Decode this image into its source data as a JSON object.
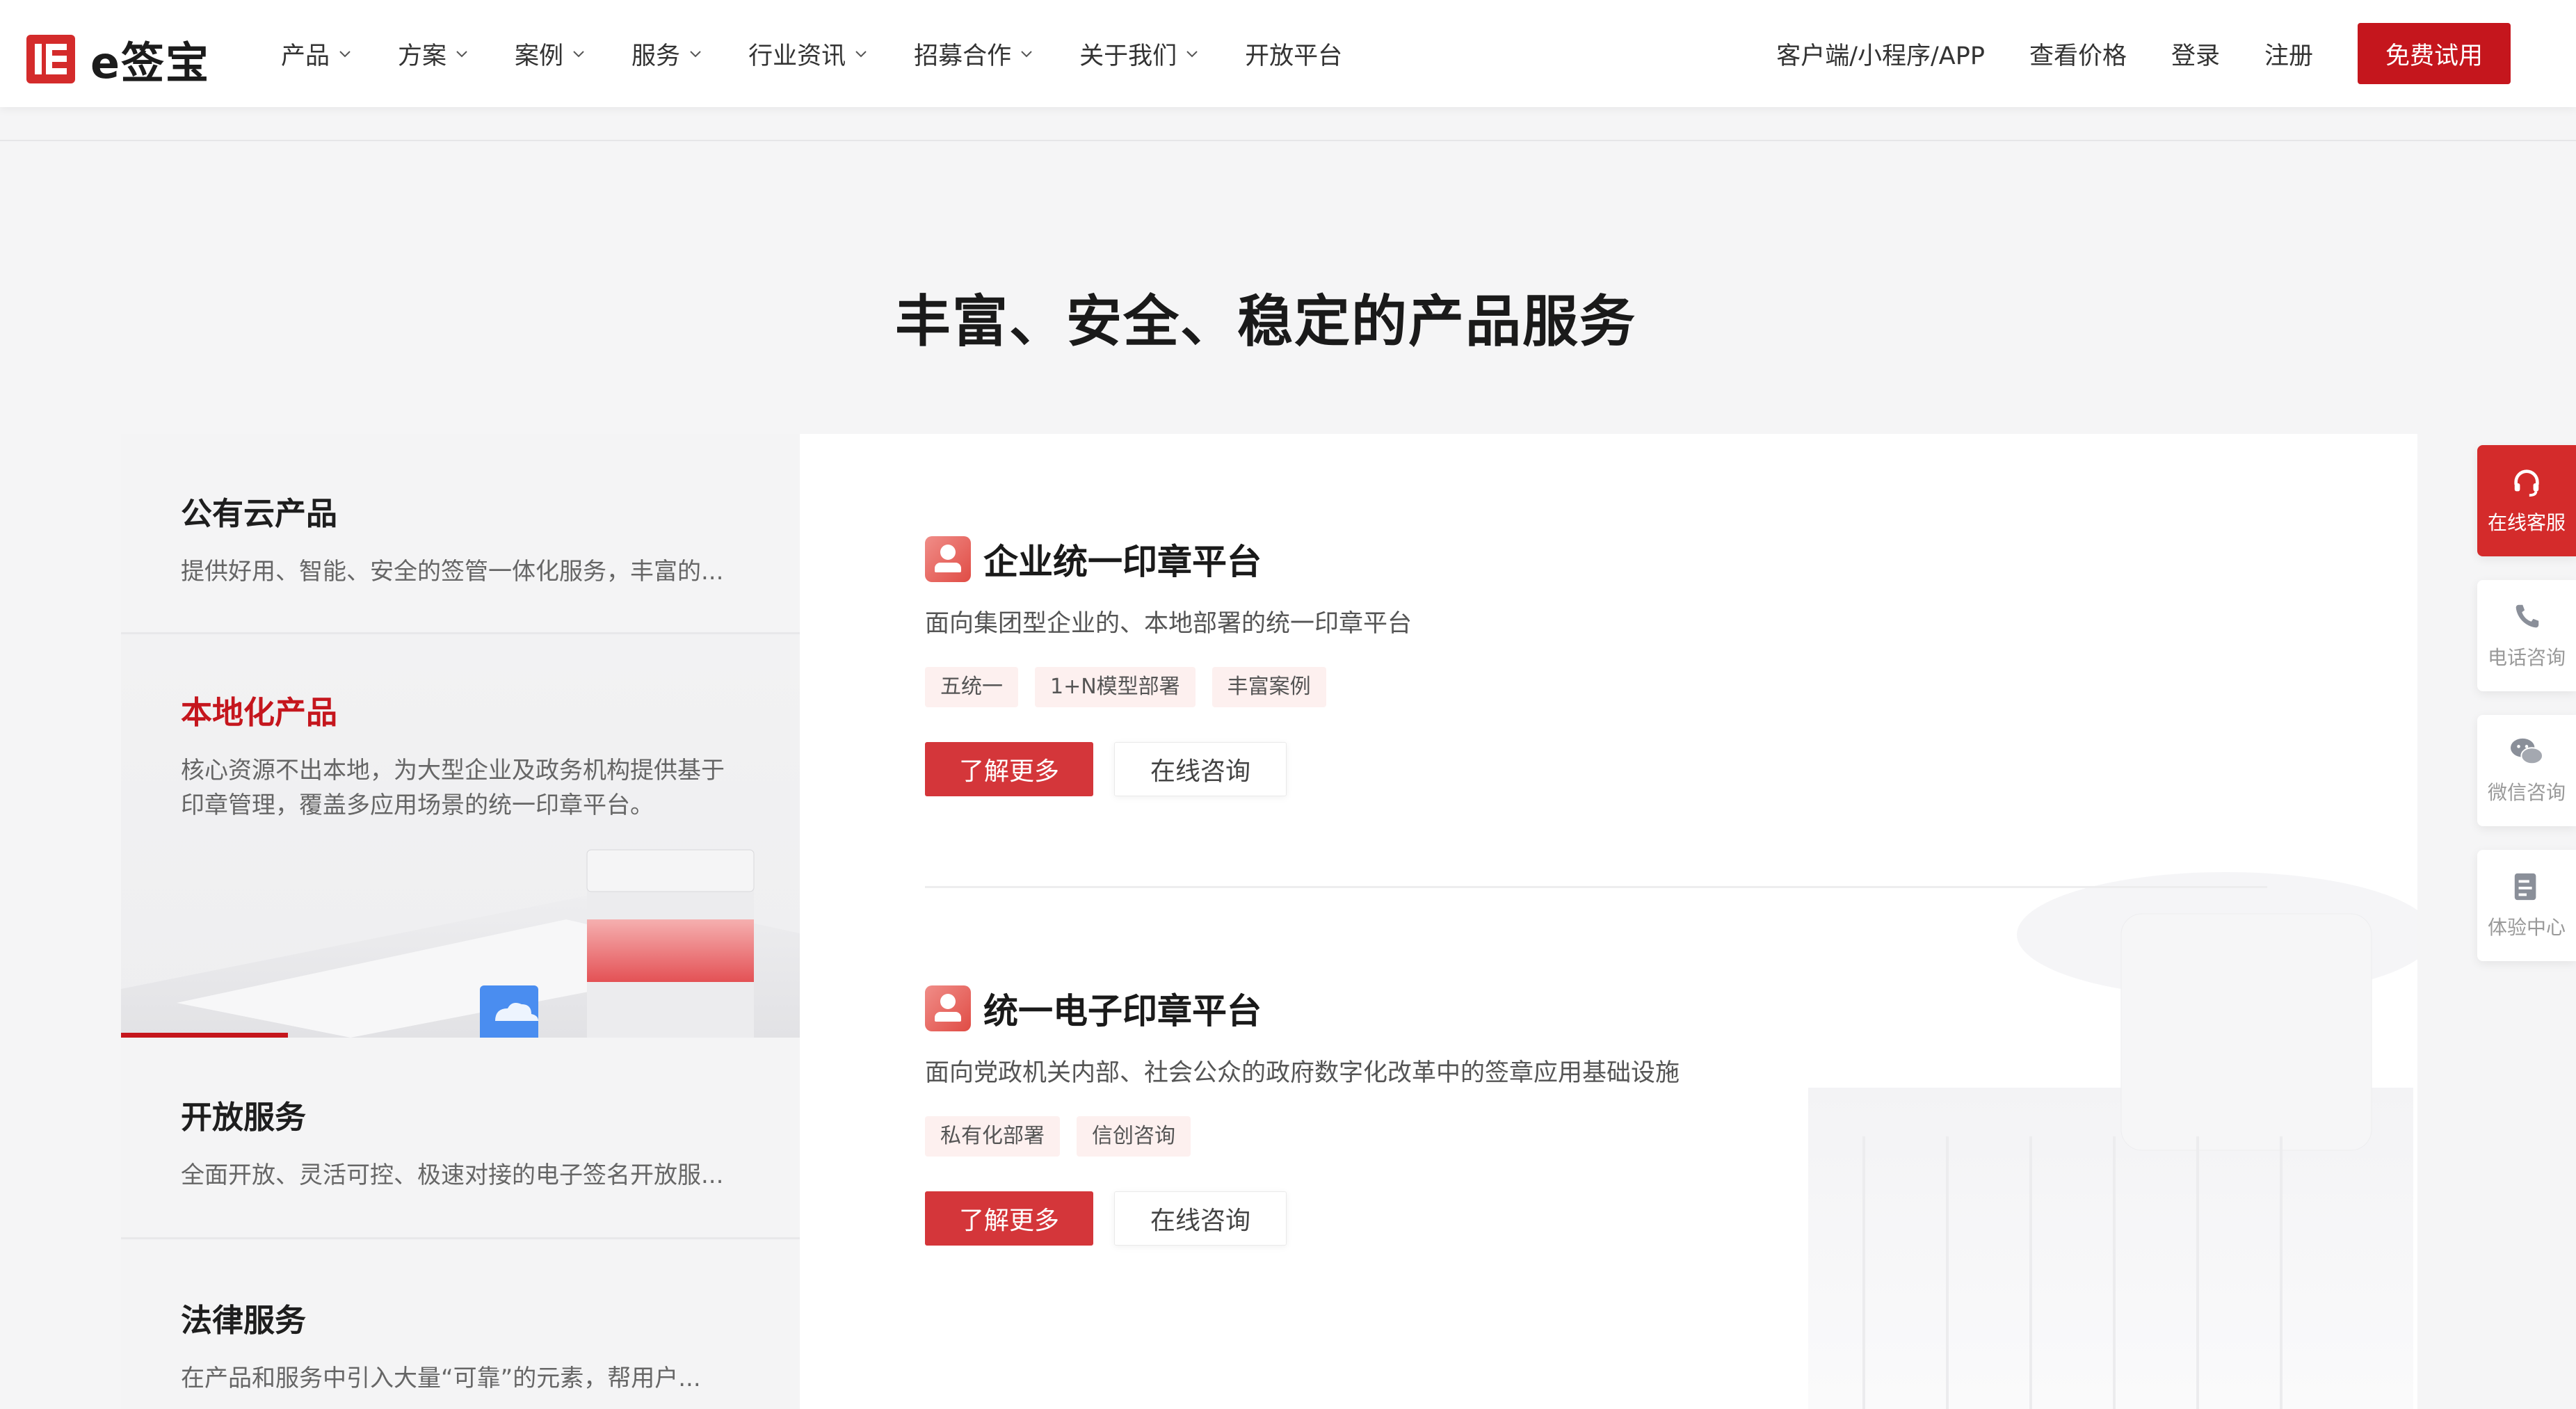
{
  "brand": {
    "name": "e签宝",
    "accent": "#c5161d"
  },
  "nav": {
    "items": [
      {
        "label": "产品",
        "dropdown": true
      },
      {
        "label": "方案",
        "dropdown": true
      },
      {
        "label": "案例",
        "dropdown": true
      },
      {
        "label": "服务",
        "dropdown": true
      },
      {
        "label": "行业资讯",
        "dropdown": true
      },
      {
        "label": "招募合作",
        "dropdown": true
      },
      {
        "label": "关于我们",
        "dropdown": true
      },
      {
        "label": "开放平台",
        "dropdown": false
      }
    ],
    "right_links": [
      "客户端/小程序/APP",
      "查看价格",
      "登录",
      "注册"
    ],
    "cta": "免费试用"
  },
  "section": {
    "title": "丰富、安全、稳定的产品服务"
  },
  "tabs": [
    {
      "title": "公有云产品",
      "desc": "提供好用、智能、安全的签管一体化服务，丰富的..."
    },
    {
      "title": "本地化产品",
      "desc": "核心资源不出本地，为大型企业及政务机构提供基于印章管理，覆盖多应用场景的统一印章平台。",
      "active": true
    },
    {
      "title": "开放服务",
      "desc": "全面开放、灵活可控、极速对接的电子签名开放服..."
    },
    {
      "title": "法律服务",
      "desc": "在产品和服务中引入大量“可靠”的元素，帮用户..."
    }
  ],
  "products": [
    {
      "name": "企业统一印章平台",
      "desc": "面向集团型企业的、本地部署的统一印章平台",
      "tags": [
        "五统一",
        "1+N模型部署",
        "丰富案例"
      ],
      "primary": "了解更多",
      "secondary": "在线咨询"
    },
    {
      "name": "统一电子印章平台",
      "desc": "面向党政机关内部、社会公众的政府数字化改革中的签章应用基础设施",
      "tags": [
        "私有化部署",
        "信创咨询"
      ],
      "primary": "了解更多",
      "secondary": "在线咨询"
    }
  ],
  "float_bar": [
    {
      "label": "在线客服",
      "icon": "headset-icon"
    },
    {
      "label": "电话咨询",
      "icon": "phone-icon"
    },
    {
      "label": "微信咨询",
      "icon": "wechat-icon"
    },
    {
      "label": "体验中心",
      "icon": "document-icon"
    }
  ]
}
